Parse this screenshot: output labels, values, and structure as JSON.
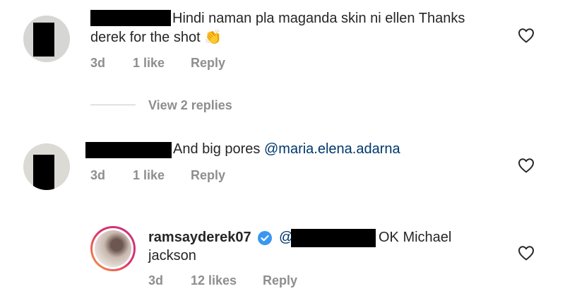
{
  "comments": [
    {
      "text_line1": "Hindi naman pla maganda skin ni ellen Thanks",
      "text_line2": "derek for the shot",
      "emoji": "👏",
      "time": "3d",
      "likes": "1 like",
      "reply_label": "Reply"
    },
    {
      "text": "And big pores ",
      "mention": "@maria.elena.adarna",
      "time": "3d",
      "likes": "1 like",
      "reply_label": "Reply"
    }
  ],
  "view_replies": "View 2 replies",
  "reply": {
    "username": "ramsayderek07",
    "text_line1_prefix": "@",
    "text_line1": "OK Michael",
    "text_line2": "jackson",
    "time": "3d",
    "likes": "12 likes",
    "reply_label": "Reply"
  },
  "colors": {
    "text": "#262626",
    "meta": "#8e8e8e",
    "mention": "#00376b",
    "verified": "#3897f0",
    "redaction": "#000000"
  }
}
